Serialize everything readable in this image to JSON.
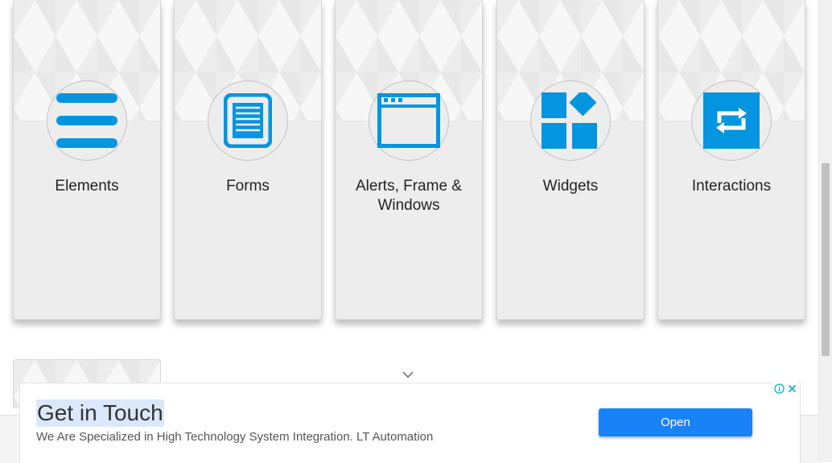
{
  "cards": [
    {
      "title": "Elements",
      "icon": "hamburger-menu-icon"
    },
    {
      "title": "Forms",
      "icon": "document-icon"
    },
    {
      "title": "Alerts, Frame & Windows",
      "icon": "browser-window-icon"
    },
    {
      "title": "Widgets",
      "icon": "widgets-icon"
    },
    {
      "title": "Interactions",
      "icon": "swap-arrows-icon"
    }
  ],
  "ad": {
    "title": "Get in Touch",
    "text": "We Are Specialized in High Technology System Integration. LT Automation",
    "button_label": "Open",
    "info_icon": "info-icon",
    "close_icon": "close-icon"
  },
  "colors": {
    "accent": "#0395e0",
    "card_bg": "#ededed",
    "ad_button": "#1a82f8"
  }
}
